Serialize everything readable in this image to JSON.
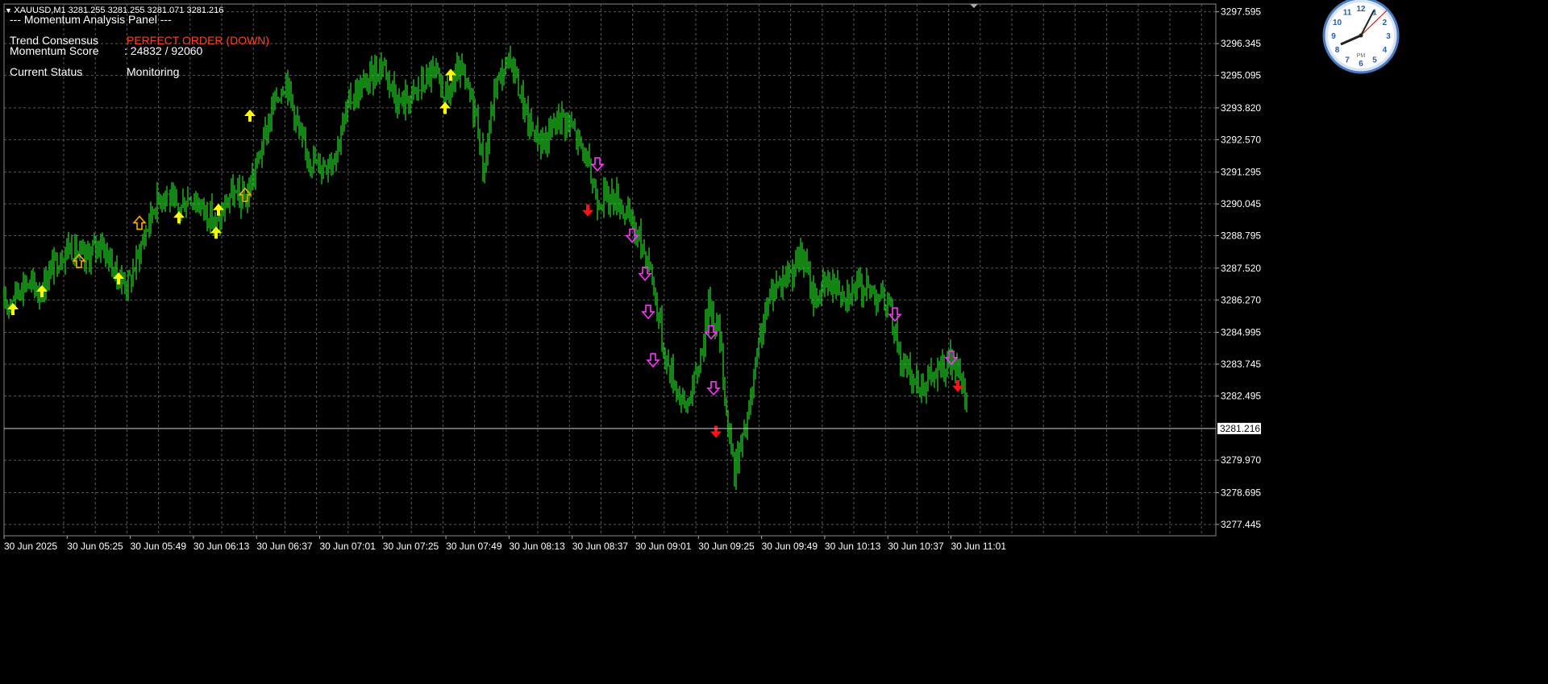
{
  "header": {
    "symbol_info": "XAUUSD,M1  3281.255 3281.255 3281.071 3281.216",
    "panel_title": "--- Momentum Analysis Panel ---"
  },
  "panel": {
    "trend_label": "Trend Consensus",
    "trend_value": "PERFECT ORDER (DOWN)",
    "momentum_label": "Momentum Score",
    "momentum_value": ": 24832 / 92060",
    "status_label": "Current Status",
    "status_value": "Monitoring"
  },
  "colors": {
    "background": "#000000",
    "grid": "#5a5a5a",
    "candles": "#22dd22",
    "panel_value_trend": "#ff4422",
    "arrow_up": "#ffff00",
    "arrow_up_hollow": "#ffaa00",
    "arrow_down_hollow": "#ff33ff",
    "arrow_down_solid": "#ff1111"
  },
  "clock": {
    "label": "PM",
    "numbers": [
      "12",
      "1",
      "2",
      "3",
      "4",
      "5",
      "6",
      "7",
      "8",
      "9",
      "10",
      "11"
    ]
  },
  "chart_data": {
    "type": "line",
    "current_price": "3281.216",
    "yticks": [
      "3297.595",
      "3296.345",
      "3295.095",
      "3293.820",
      "3292.570",
      "3291.295",
      "3290.045",
      "3288.795",
      "3287.520",
      "3286.270",
      "3284.995",
      "3283.745",
      "3282.495",
      "3279.970",
      "3278.695",
      "3277.445"
    ],
    "ylim": [
      3277.0,
      3297.9
    ],
    "xticks": [
      "30 Jun 2025",
      "30 Jun 05:25",
      "30 Jun 05:49",
      "30 Jun 06:13",
      "30 Jun 06:37",
      "30 Jun 07:01",
      "30 Jun 07:25",
      "30 Jun 07:49",
      "30 Jun 08:13",
      "30 Jun 08:37",
      "30 Jun 09:01",
      "30 Jun 09:25",
      "30 Jun 09:49",
      "30 Jun 10:13",
      "30 Jun 10:37",
      "30 Jun 11:01"
    ],
    "price_path": [
      [
        0,
        3286.0
      ],
      [
        10,
        3286.4
      ],
      [
        25,
        3287.0
      ],
      [
        45,
        3286.6
      ],
      [
        60,
        3287.6
      ],
      [
        80,
        3288.4
      ],
      [
        100,
        3287.8
      ],
      [
        120,
        3288.6
      ],
      [
        140,
        3287.2
      ],
      [
        155,
        3286.9
      ],
      [
        170,
        3288.4
      ],
      [
        185,
        3289.9
      ],
      [
        200,
        3290.6
      ],
      [
        215,
        3289.7
      ],
      [
        230,
        3290.4
      ],
      [
        250,
        3289.8
      ],
      [
        265,
        3289.2
      ],
      [
        280,
        3290.4
      ],
      [
        300,
        3290.2
      ],
      [
        320,
        3292.3
      ],
      [
        335,
        3294.0
      ],
      [
        350,
        3295.0
      ],
      [
        370,
        3292.3
      ],
      [
        390,
        3291.5
      ],
      [
        410,
        3292.0
      ],
      [
        430,
        3294.2
      ],
      [
        450,
        3294.8
      ],
      [
        470,
        3295.6
      ],
      [
        490,
        3294.0
      ],
      [
        510,
        3294.4
      ],
      [
        530,
        3295.2
      ],
      [
        550,
        3294.2
      ],
      [
        565,
        3295.3
      ],
      [
        585,
        3293.7
      ],
      [
        595,
        3291.3
      ],
      [
        610,
        3294.8
      ],
      [
        630,
        3295.7
      ],
      [
        650,
        3293.2
      ],
      [
        670,
        3292.4
      ],
      [
        690,
        3293.6
      ],
      [
        705,
        3293.0
      ],
      [
        720,
        3292.0
      ],
      [
        735,
        3290.3
      ],
      [
        745,
        3290.3
      ],
      [
        760,
        3290.3
      ],
      [
        780,
        3289.2
      ],
      [
        800,
        3287.8
      ],
      [
        810,
        3286.0
      ],
      [
        820,
        3284.0
      ],
      [
        830,
        3283.2
      ],
      [
        845,
        3282.0
      ],
      [
        860,
        3283.4
      ],
      [
        875,
        3286.2
      ],
      [
        888,
        3284.8
      ],
      [
        895,
        3282.2
      ],
      [
        905,
        3279.6
      ],
      [
        915,
        3280.6
      ],
      [
        925,
        3282.0
      ],
      [
        940,
        3285.2
      ],
      [
        955,
        3286.8
      ],
      [
        975,
        3287.4
      ],
      [
        990,
        3288.0
      ],
      [
        1005,
        3286.3
      ],
      [
        1025,
        3287.0
      ],
      [
        1045,
        3286.6
      ],
      [
        1065,
        3286.8
      ],
      [
        1085,
        3286.5
      ],
      [
        1100,
        3285.8
      ],
      [
        1115,
        3283.6
      ],
      [
        1135,
        3282.9
      ],
      [
        1155,
        3283.3
      ],
      [
        1175,
        3283.9
      ],
      [
        1190,
        3282.8
      ],
      [
        1200,
        3281.2
      ]
    ],
    "markers": [
      {
        "type": "up",
        "x": 16,
        "p": 3285.9
      },
      {
        "type": "up",
        "x": 52,
        "p": 3286.6
      },
      {
        "type": "up_hollow",
        "x": 98,
        "p": 3287.8
      },
      {
        "type": "up",
        "x": 147,
        "p": 3287.1
      },
      {
        "type": "up_hollow",
        "x": 173,
        "p": 3289.3
      },
      {
        "type": "up",
        "x": 222,
        "p": 3289.5
      },
      {
        "type": "up",
        "x": 268,
        "p": 3288.9
      },
      {
        "type": "up",
        "x": 271,
        "p": 3289.8
      },
      {
        "type": "up_hollow",
        "x": 304,
        "p": 3290.4
      },
      {
        "type": "up",
        "x": 310,
        "p": 3293.5
      },
      {
        "type": "up",
        "x": 552,
        "p": 3293.8
      },
      {
        "type": "up",
        "x": 559,
        "p": 3295.1
      },
      {
        "type": "down_solid",
        "x": 729,
        "p": 3289.8
      },
      {
        "type": "down_hollow",
        "x": 741,
        "p": 3291.6
      },
      {
        "type": "down_hollow",
        "x": 784,
        "p": 3288.8
      },
      {
        "type": "down_hollow",
        "x": 800,
        "p": 3287.3
      },
      {
        "type": "down_hollow",
        "x": 804,
        "p": 3285.8
      },
      {
        "type": "down_hollow",
        "x": 810,
        "p": 3283.9
      },
      {
        "type": "down_hollow",
        "x": 882,
        "p": 3285.0
      },
      {
        "type": "down_hollow",
        "x": 885,
        "p": 3282.8
      },
      {
        "type": "down_solid",
        "x": 888,
        "p": 3281.1
      },
      {
        "type": "down_hollow",
        "x": 1110,
        "p": 3285.7
      },
      {
        "type": "down_hollow",
        "x": 1180,
        "p": 3284.0
      },
      {
        "type": "down_solid",
        "x": 1188,
        "p": 3282.9
      }
    ]
  }
}
